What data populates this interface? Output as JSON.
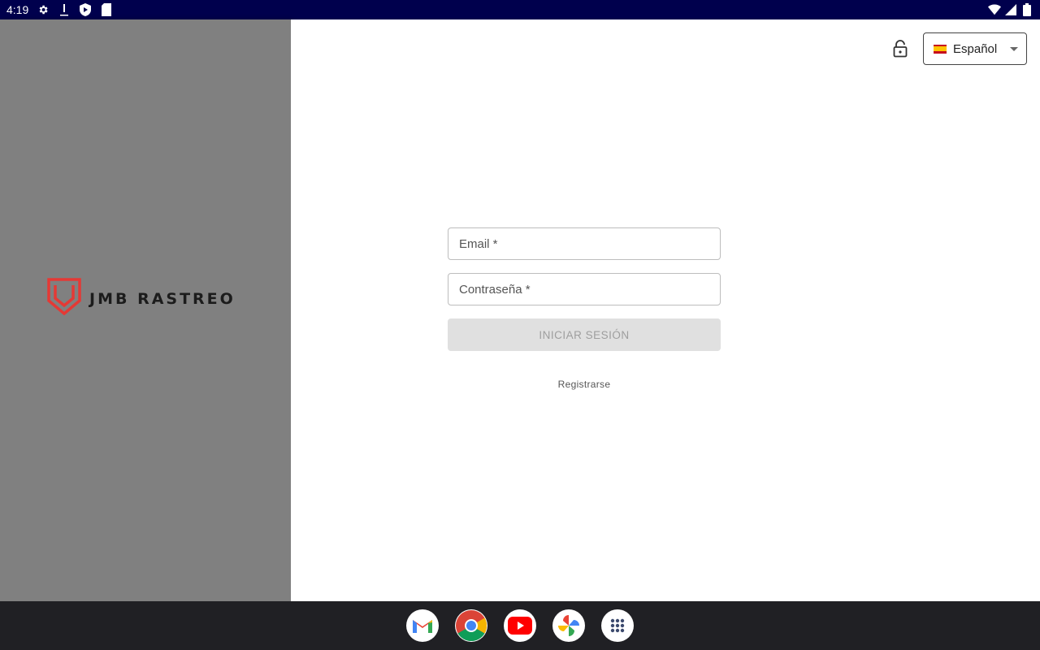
{
  "status_bar": {
    "time": "4:19",
    "icons": [
      "settings-icon",
      "download-icon",
      "shield-icon",
      "sd-card-icon",
      "wifi-icon",
      "signal-icon",
      "battery-icon"
    ]
  },
  "brand": {
    "name": "JMB RASTREO",
    "accent_color": "#e53935"
  },
  "header": {
    "lock_icon": "lock-open-icon",
    "language": {
      "selected": "Español",
      "flag": "spain-flag-icon"
    }
  },
  "login_form": {
    "email_placeholder": "Email *",
    "password_placeholder": "Contraseña *",
    "submit_label": "INICIAR SESIÓN",
    "register_label": "Registrarse"
  },
  "taskbar": {
    "apps": [
      "gmail-icon",
      "chrome-icon",
      "youtube-icon",
      "photos-icon",
      "app-drawer-icon"
    ]
  }
}
